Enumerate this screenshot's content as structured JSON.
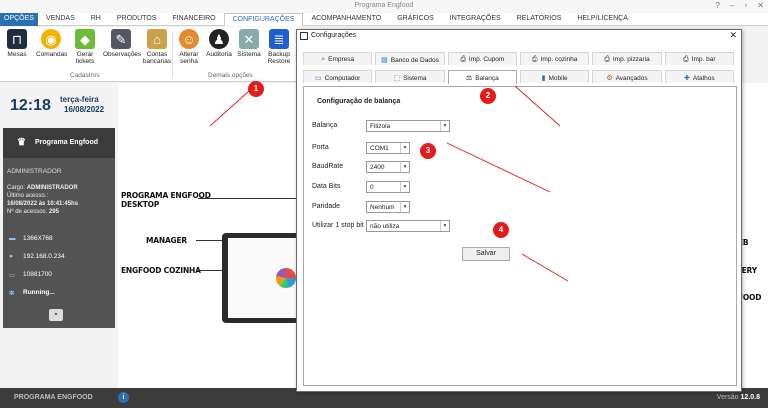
{
  "app": {
    "title": "Programa Engfood"
  },
  "window_controls": [
    "?",
    "–",
    "▫",
    "✕"
  ],
  "menu": [
    {
      "label": "OPÇÕES",
      "state": "first"
    },
    {
      "label": "VENDAS"
    },
    {
      "label": "RH"
    },
    {
      "label": "PRODUTOS"
    },
    {
      "label": "FINANCEIRO"
    },
    {
      "label": "CONFIGURAÇÕES",
      "state": "active"
    },
    {
      "label": "ACOMPANHAMENTO"
    },
    {
      "label": "GRÁFICOS"
    },
    {
      "label": "INTEGRAÇÕES"
    },
    {
      "label": "RELATÓRIOS"
    },
    {
      "label": "HELP/LICENÇA"
    }
  ],
  "ribbon": {
    "buttons": [
      "Mesas",
      "Comandas",
      "Gerar tickets",
      "Observações",
      "Contas bancarias",
      "Alterar senha",
      "Auditoria",
      "Sistema",
      "Backup Restore"
    ],
    "groups": [
      "Cadastros",
      "Demais opções"
    ]
  },
  "left": {
    "clock": "12:18",
    "weekday": "terça-feira",
    "date": "16/08/2022",
    "program": "Programa Engfood",
    "admin": "ADMINISTRADOR",
    "cargo_label": "Cargo:",
    "cargo": "ADMINISTRADOR",
    "last_access_label": "Último acesso.:",
    "last_access": "16/08/2022 às 10:41:45hs",
    "accesses_label": "Nº de acessos:",
    "accesses": "295",
    "resolution": "1366X768",
    "ip": "192.168.0.234",
    "port": "10881700",
    "running": "Running..."
  },
  "main": {
    "labels": [
      "PROGRAMA ENGFOOD DESKTOP",
      "MANAGER",
      "ENGFOOD COZINHA"
    ],
    "right_cut": [
      "EB",
      "VERY",
      "GFOOD"
    ]
  },
  "status": {
    "left": "PROGRAMA ENGFOOD",
    "version_label": "Versão",
    "version": "12.0.8"
  },
  "dialog": {
    "title": "Configurações",
    "tabs_row1": [
      {
        "label": "Empresa",
        "icon": "🔍"
      },
      {
        "label": "Banco de Dados",
        "icon": "▤"
      },
      {
        "label": "Imp. Cupom",
        "icon": "⎙"
      },
      {
        "label": "Imp. cozinha",
        "icon": "⎙"
      },
      {
        "label": "Imp. pizzaria",
        "icon": "⎙"
      },
      {
        "label": "Imp. bar",
        "icon": "⎙"
      }
    ],
    "tabs_row2": [
      {
        "label": "Computador",
        "icon": "▭"
      },
      {
        "label": "Sistema",
        "icon": "⬚"
      },
      {
        "label": "Balança",
        "icon": "⚖",
        "selected": true
      },
      {
        "label": "Mobile",
        "icon": "▮"
      },
      {
        "label": "Avançados",
        "icon": "⚙"
      },
      {
        "label": "Atalhos",
        "icon": "✚"
      }
    ],
    "panel_title": "Configuração de balança",
    "fields": [
      {
        "label": "Balança",
        "value": "Filizola"
      },
      {
        "label": "Porta",
        "value": "COM1"
      },
      {
        "label": "BaudRate",
        "value": "2400"
      },
      {
        "label": "Data Bits",
        "value": "0"
      },
      {
        "label": "Paridade",
        "value": "Nenhum"
      },
      {
        "label": "Utilizar 1 stop bit",
        "value": "não utiliza"
      }
    ],
    "save_label": "Salvar"
  },
  "badges": [
    "1",
    "2",
    "3",
    "4"
  ],
  "colors": {
    "accent": "#2a6fb0",
    "badge": "#e21b1b",
    "dark_panel": "#535353",
    "status_bar": "#3c3c3c"
  }
}
